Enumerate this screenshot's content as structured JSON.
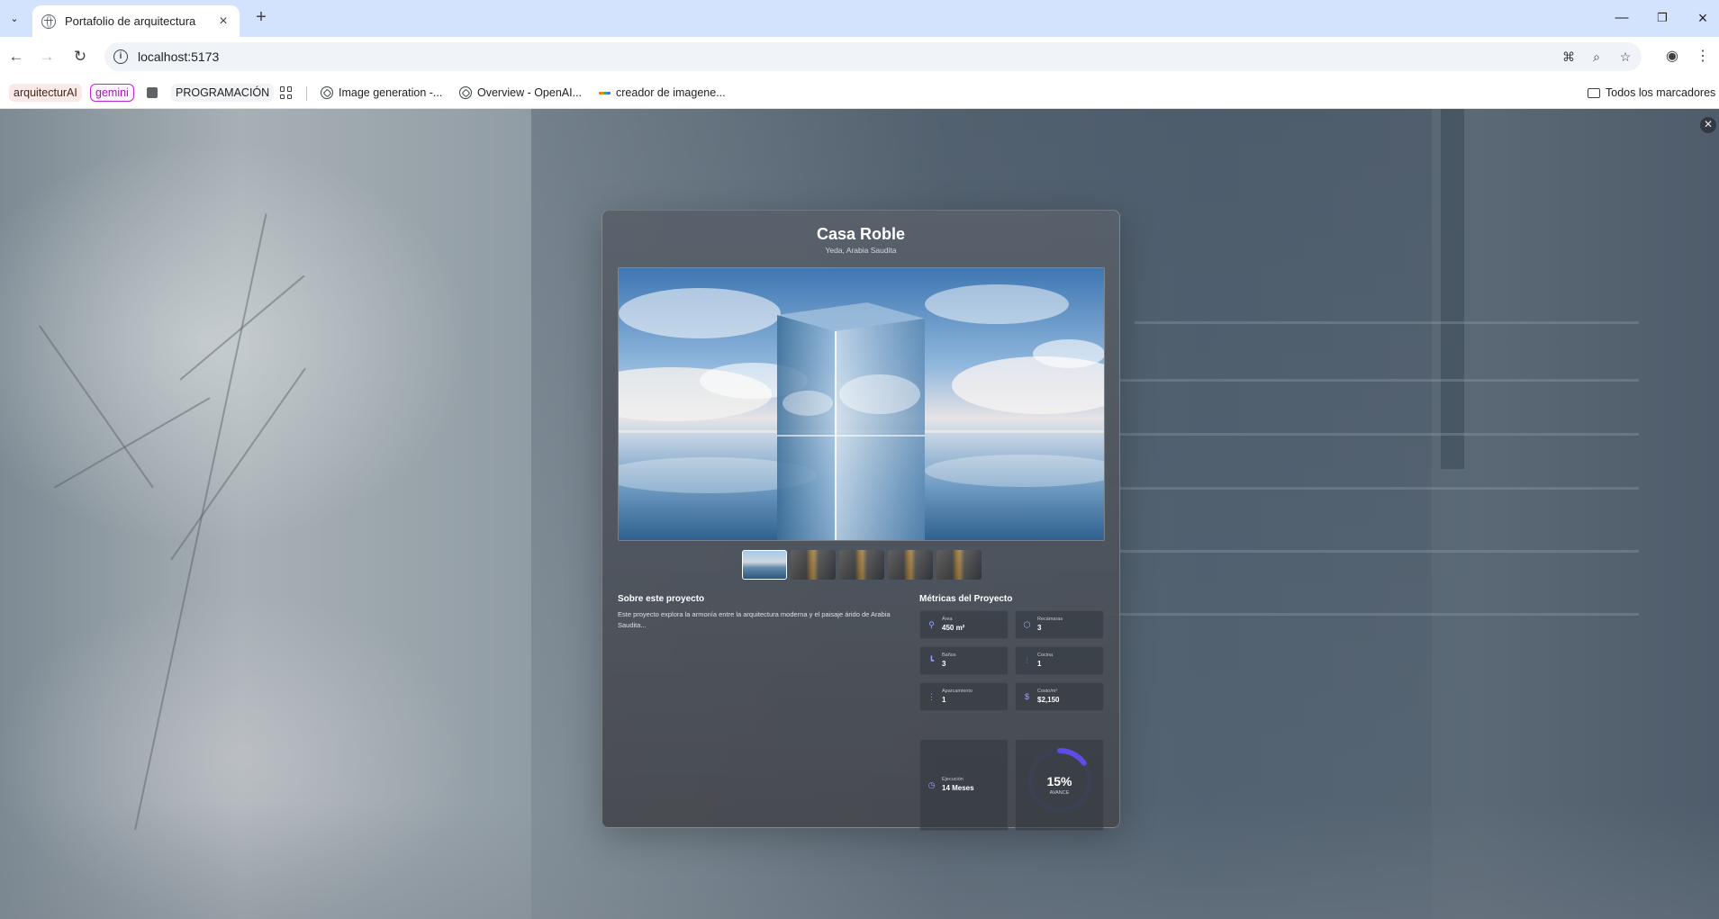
{
  "browser": {
    "tab_title": "Portafolio de arquitectura",
    "url": "localhost:5173",
    "bookmarks": [
      "arquitecturAI",
      "gemini",
      "PROGRAMACIÓN",
      "Image generation -...",
      "Overview - OpenAI...",
      "creador de imagene..."
    ],
    "bookmarks_folder": "Todos los marcadores"
  },
  "project": {
    "title": "Casa Roble",
    "location": "Yeda, Arabia Saudita",
    "about_title": "Sobre este proyecto",
    "about_text": "Este proyecto explora la armonía entre la arquitectura moderna y el paisaje árido de Arabia Saudita...",
    "metrics_title": "Métricas del Proyecto",
    "metrics": [
      {
        "icon": "area-icon",
        "label": "Área",
        "value": "450 m²"
      },
      {
        "icon": "bedroom-icon",
        "label": "Recámaras",
        "value": "3"
      },
      {
        "icon": "bath-icon",
        "label": "Baños",
        "value": "3"
      },
      {
        "icon": "kitchen-icon",
        "label": "Cocina",
        "value": "1"
      },
      {
        "icon": "parking-icon",
        "label": "Aparcamiento",
        "value": "1"
      },
      {
        "icon": "dollar-icon",
        "label": "Costo/m²",
        "value": "$2,150"
      },
      {
        "icon": "clock-icon",
        "label": "Ejecución",
        "value": "14 Meses"
      }
    ],
    "progress": {
      "percent_text": "15%",
      "label": "AVANCE",
      "fraction": 0.15
    },
    "thumbnails_count": 5,
    "active_thumbnail": 0
  },
  "colors": {
    "accent": "#5b4de6"
  }
}
